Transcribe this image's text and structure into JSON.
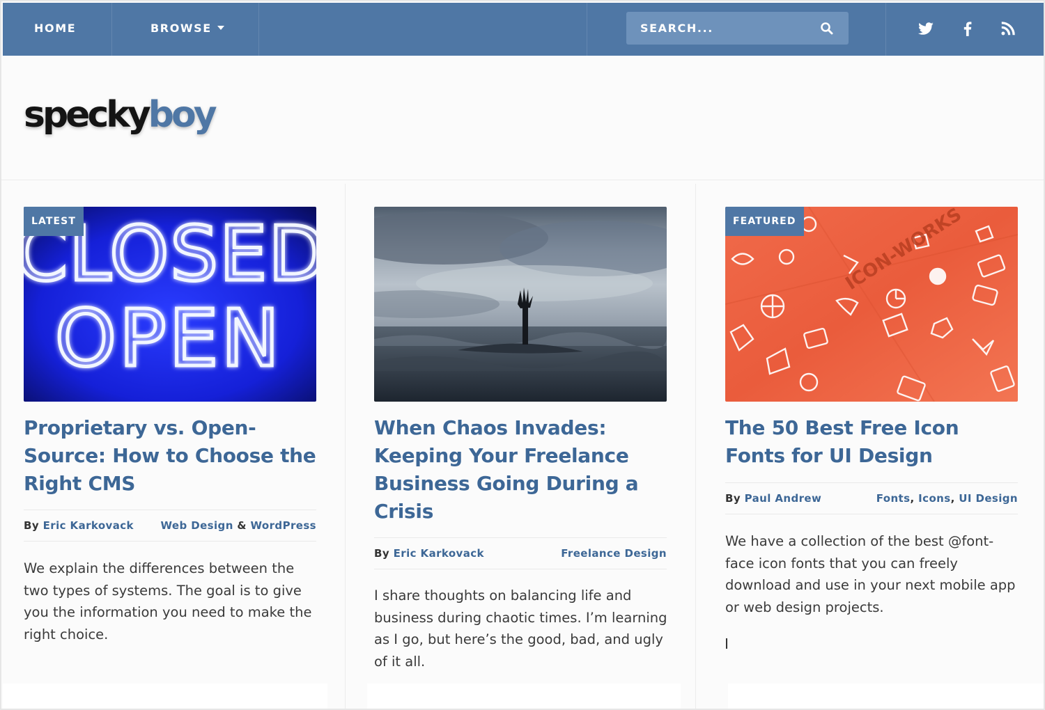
{
  "nav": {
    "home": "HOME",
    "browse": "BROWSE",
    "search_placeholder": "SEARCH..."
  },
  "icons": {
    "search": "search-icon",
    "twitter": "twitter-icon",
    "facebook": "facebook-icon",
    "rss": "rss-icon",
    "browse_caret": "chevron-down-icon"
  },
  "site": {
    "logo_part1": "specky",
    "logo_part2": "boy"
  },
  "colors": {
    "brand": "#4f77a5",
    "link": "#3d6796",
    "search_bg": "#6e92bb"
  },
  "cards": [
    {
      "badge": "LATEST",
      "image_text": [
        "CLOSED",
        "OPEN"
      ],
      "title": "Proprietary vs. Open-Source: How to Choose the Right CMS",
      "by": "By",
      "author": "Eric Karkovack",
      "cat1": "Web Design",
      "amp": "&",
      "cat2": "WordPress",
      "excerpt": "We explain the differences between the two types of systems. The goal is to give you the information you need to make the right choice."
    },
    {
      "badge": "",
      "title": "When Chaos Invades: Keeping Your Freelance Business Going During a Crisis",
      "by": "By",
      "author": "Eric Karkovack",
      "cat1": "Freelance Design",
      "excerpt": "I share thoughts on balancing life and business during chaotic times. I’m learning as I go, but here’s the good, bad, and ugly of it all."
    },
    {
      "badge": "FEATURED",
      "image_text": "ICON-WORKS",
      "title": "The 50 Best Free Icon Fonts for UI Design",
      "by": "By",
      "author": "Paul Andrew",
      "cat1": "Fonts",
      "sep1": ",",
      "cat2": "Icons",
      "sep2": ",",
      "cat3": "UI Design",
      "excerpt": "We have a collection of the best @font-face icon fonts that you can freely download and use in your next mobile app or web design projects."
    }
  ]
}
